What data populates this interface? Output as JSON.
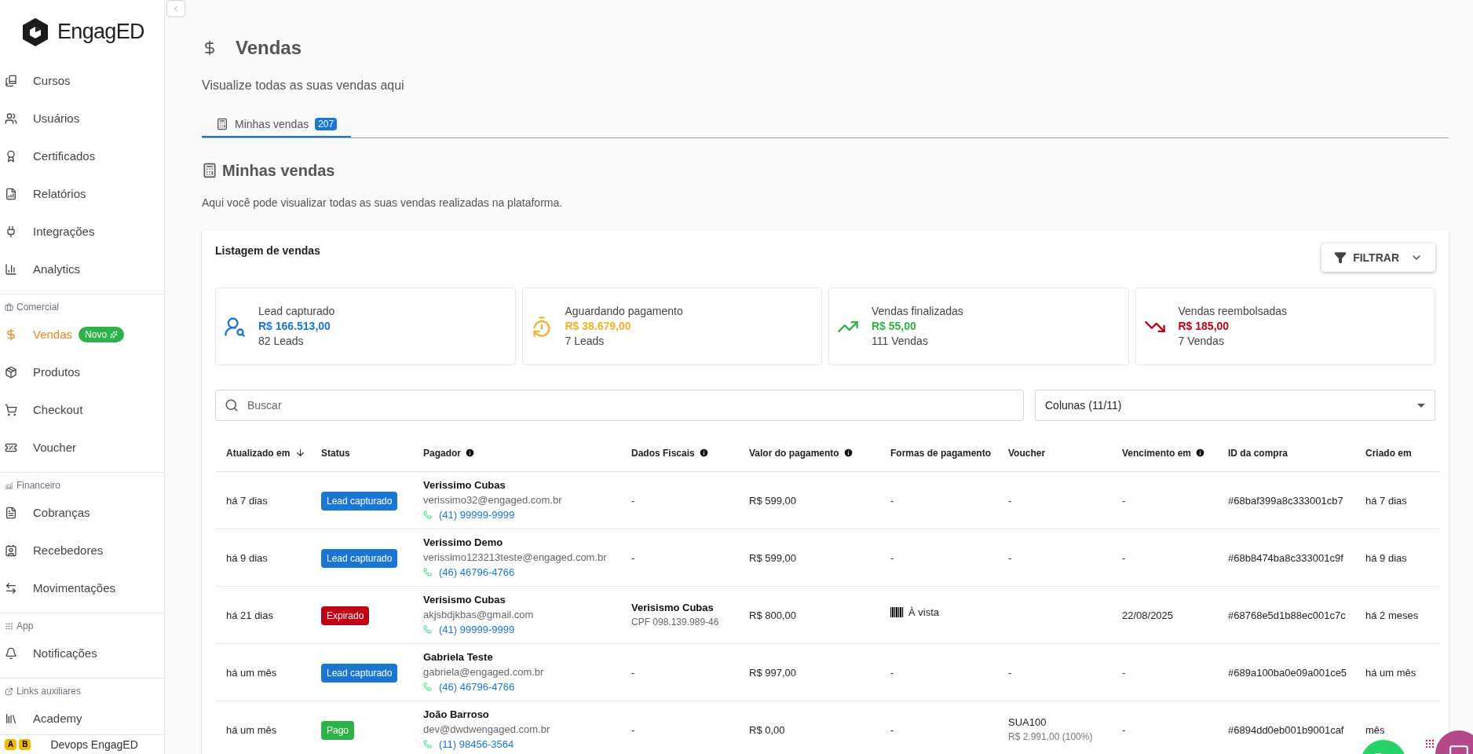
{
  "logo": {
    "text": "EngagED"
  },
  "sidebar": {
    "sections": [
      {
        "items": [
          {
            "label": "Cursos",
            "selected": false
          },
          {
            "label": "Usuários",
            "selected": false
          },
          {
            "label": "Certificados",
            "selected": false
          },
          {
            "label": "Relatórios",
            "selected": false
          },
          {
            "label": "Integrações",
            "selected": false
          },
          {
            "label": "Analytics",
            "selected": false
          }
        ]
      },
      {
        "label": "Comercial",
        "items": [
          {
            "label": "Vendas",
            "selected": true,
            "badge": "Novo"
          },
          {
            "label": "Produtos",
            "selected": false
          },
          {
            "label": "Checkout",
            "selected": false
          },
          {
            "label": "Voucher",
            "selected": false
          }
        ]
      },
      {
        "label": "Financeiro",
        "items": [
          {
            "label": "Cobranças",
            "selected": false
          },
          {
            "label": "Recebedores",
            "selected": false
          },
          {
            "label": "Movimentações",
            "selected": false
          }
        ]
      },
      {
        "label": "App",
        "items": [
          {
            "label": "Notificações",
            "selected": false
          }
        ]
      },
      {
        "label": "Links auxiliares",
        "items": [
          {
            "label": "Academy",
            "selected": false
          }
        ]
      }
    ],
    "footer": {
      "badges": [
        "A",
        "B"
      ],
      "label": "Devops EngagED"
    }
  },
  "page": {
    "title": "Vendas",
    "subtitle": "Visualize todas as suas vendas aqui"
  },
  "tabs": [
    {
      "label": "Minhas vendas",
      "count": "207",
      "selected": true
    }
  ],
  "section": {
    "title": "Minhas vendas",
    "description": "Aqui você pode visualizar todas as suas vendas realizadas na plataforma."
  },
  "listing": {
    "title": "Listagem de vendas",
    "filter_button": "FILTRAR",
    "stats": [
      {
        "label": "Lead capturado",
        "value": "R$ 166.513,00",
        "count": "82 Leads",
        "color": "#1976d2"
      },
      {
        "label": "Aguardando pagamento",
        "value": "R$ 38.679,00",
        "count": "7 Leads",
        "color": "#f0b429"
      },
      {
        "label": "Vendas finalizadas",
        "value": "R$ 55,00",
        "count": "111 Vendas",
        "color": "#2eb24a"
      },
      {
        "label": "Vendas reembolsadas",
        "value": "R$ 185,00",
        "count": "7 Vendas",
        "color": "#c00015"
      }
    ],
    "search": {
      "placeholder": "Buscar"
    },
    "columns_select": {
      "value": "Colunas (11/11)"
    }
  },
  "table": {
    "columns": [
      {
        "label": "Atualizado em",
        "sorted": true
      },
      {
        "label": "Status"
      },
      {
        "label": "Pagador",
        "info": true
      },
      {
        "label": "Dados Fiscais",
        "info": true
      },
      {
        "label": "Valor do pagamento",
        "info": true
      },
      {
        "label": "Formas de pagamento"
      },
      {
        "label": "Voucher"
      },
      {
        "label": "Vencimento em",
        "info": true
      },
      {
        "label": "ID da compra"
      },
      {
        "label": "Criado em"
      }
    ],
    "rows": [
      {
        "updated": "há 7 dias",
        "status": {
          "label": "Lead capturado",
          "kind": "lead"
        },
        "payer": {
          "name": "Verissimo Cubas",
          "email": "verissimo32@engaged.com.br",
          "phone": "(41) 99999-9999"
        },
        "fiscal": "-",
        "value": "R$ 599,00",
        "payment": "-",
        "voucher": "-",
        "due": "-",
        "id": "#68baf399a8c333001cb7",
        "created": "há 7 dias"
      },
      {
        "updated": "há 9 dias",
        "status": {
          "label": "Lead capturado",
          "kind": "lead"
        },
        "payer": {
          "name": "Verissimo Demo",
          "email": "verissimo123213teste@engaged.com.br",
          "phone": "(46) 46796-4766"
        },
        "fiscal": "-",
        "value": "R$ 599,00",
        "payment": "-",
        "voucher": "-",
        "due": "-",
        "id": "#68b8474ba8c333001c9f",
        "created": "há 9 dias"
      },
      {
        "updated": "há 21 dias",
        "status": {
          "label": "Expirado",
          "kind": "expired"
        },
        "payer": {
          "name": "Verisismo Cubas",
          "email": "akjsbdjkbas@gmail.com",
          "phone": "(41) 99999-9999"
        },
        "fiscal": {
          "name": "Verisismo Cubas",
          "doc": "CPF 098.139.989-46"
        },
        "value": "R$ 800,00",
        "payment": {
          "kind": "boleto",
          "label": "À vista"
        },
        "voucher": "",
        "due": "22/08/2025",
        "id": "#68768e5d1b88ec001c7c",
        "created": "há 2 meses"
      },
      {
        "updated": "há um mês",
        "status": {
          "label": "Lead capturado",
          "kind": "lead"
        },
        "payer": {
          "name": "Gabriela Teste",
          "email": "gabriela@engaged.com.br",
          "phone": "(46) 46796-4766"
        },
        "fiscal": "-",
        "value": "R$ 997,00",
        "payment": "-",
        "voucher": "-",
        "due": "-",
        "id": "#689a100ba0e09a001ce5",
        "created": "há um mês"
      },
      {
        "updated": "há um mês",
        "status": {
          "label": "Pago",
          "kind": "paid"
        },
        "payer": {
          "name": "João Barroso",
          "email": "dev@dwdwengaged.com.br",
          "phone": "(11) 98456-3564"
        },
        "fiscal": "-",
        "value": "R$ 0,00",
        "payment": "-",
        "voucher": {
          "code": "SUA100",
          "detail": "R$ 2.991,00 (100%)"
        },
        "due": "-",
        "id": "#6894dd0eb001b9001caf",
        "created": "mês"
      }
    ]
  }
}
